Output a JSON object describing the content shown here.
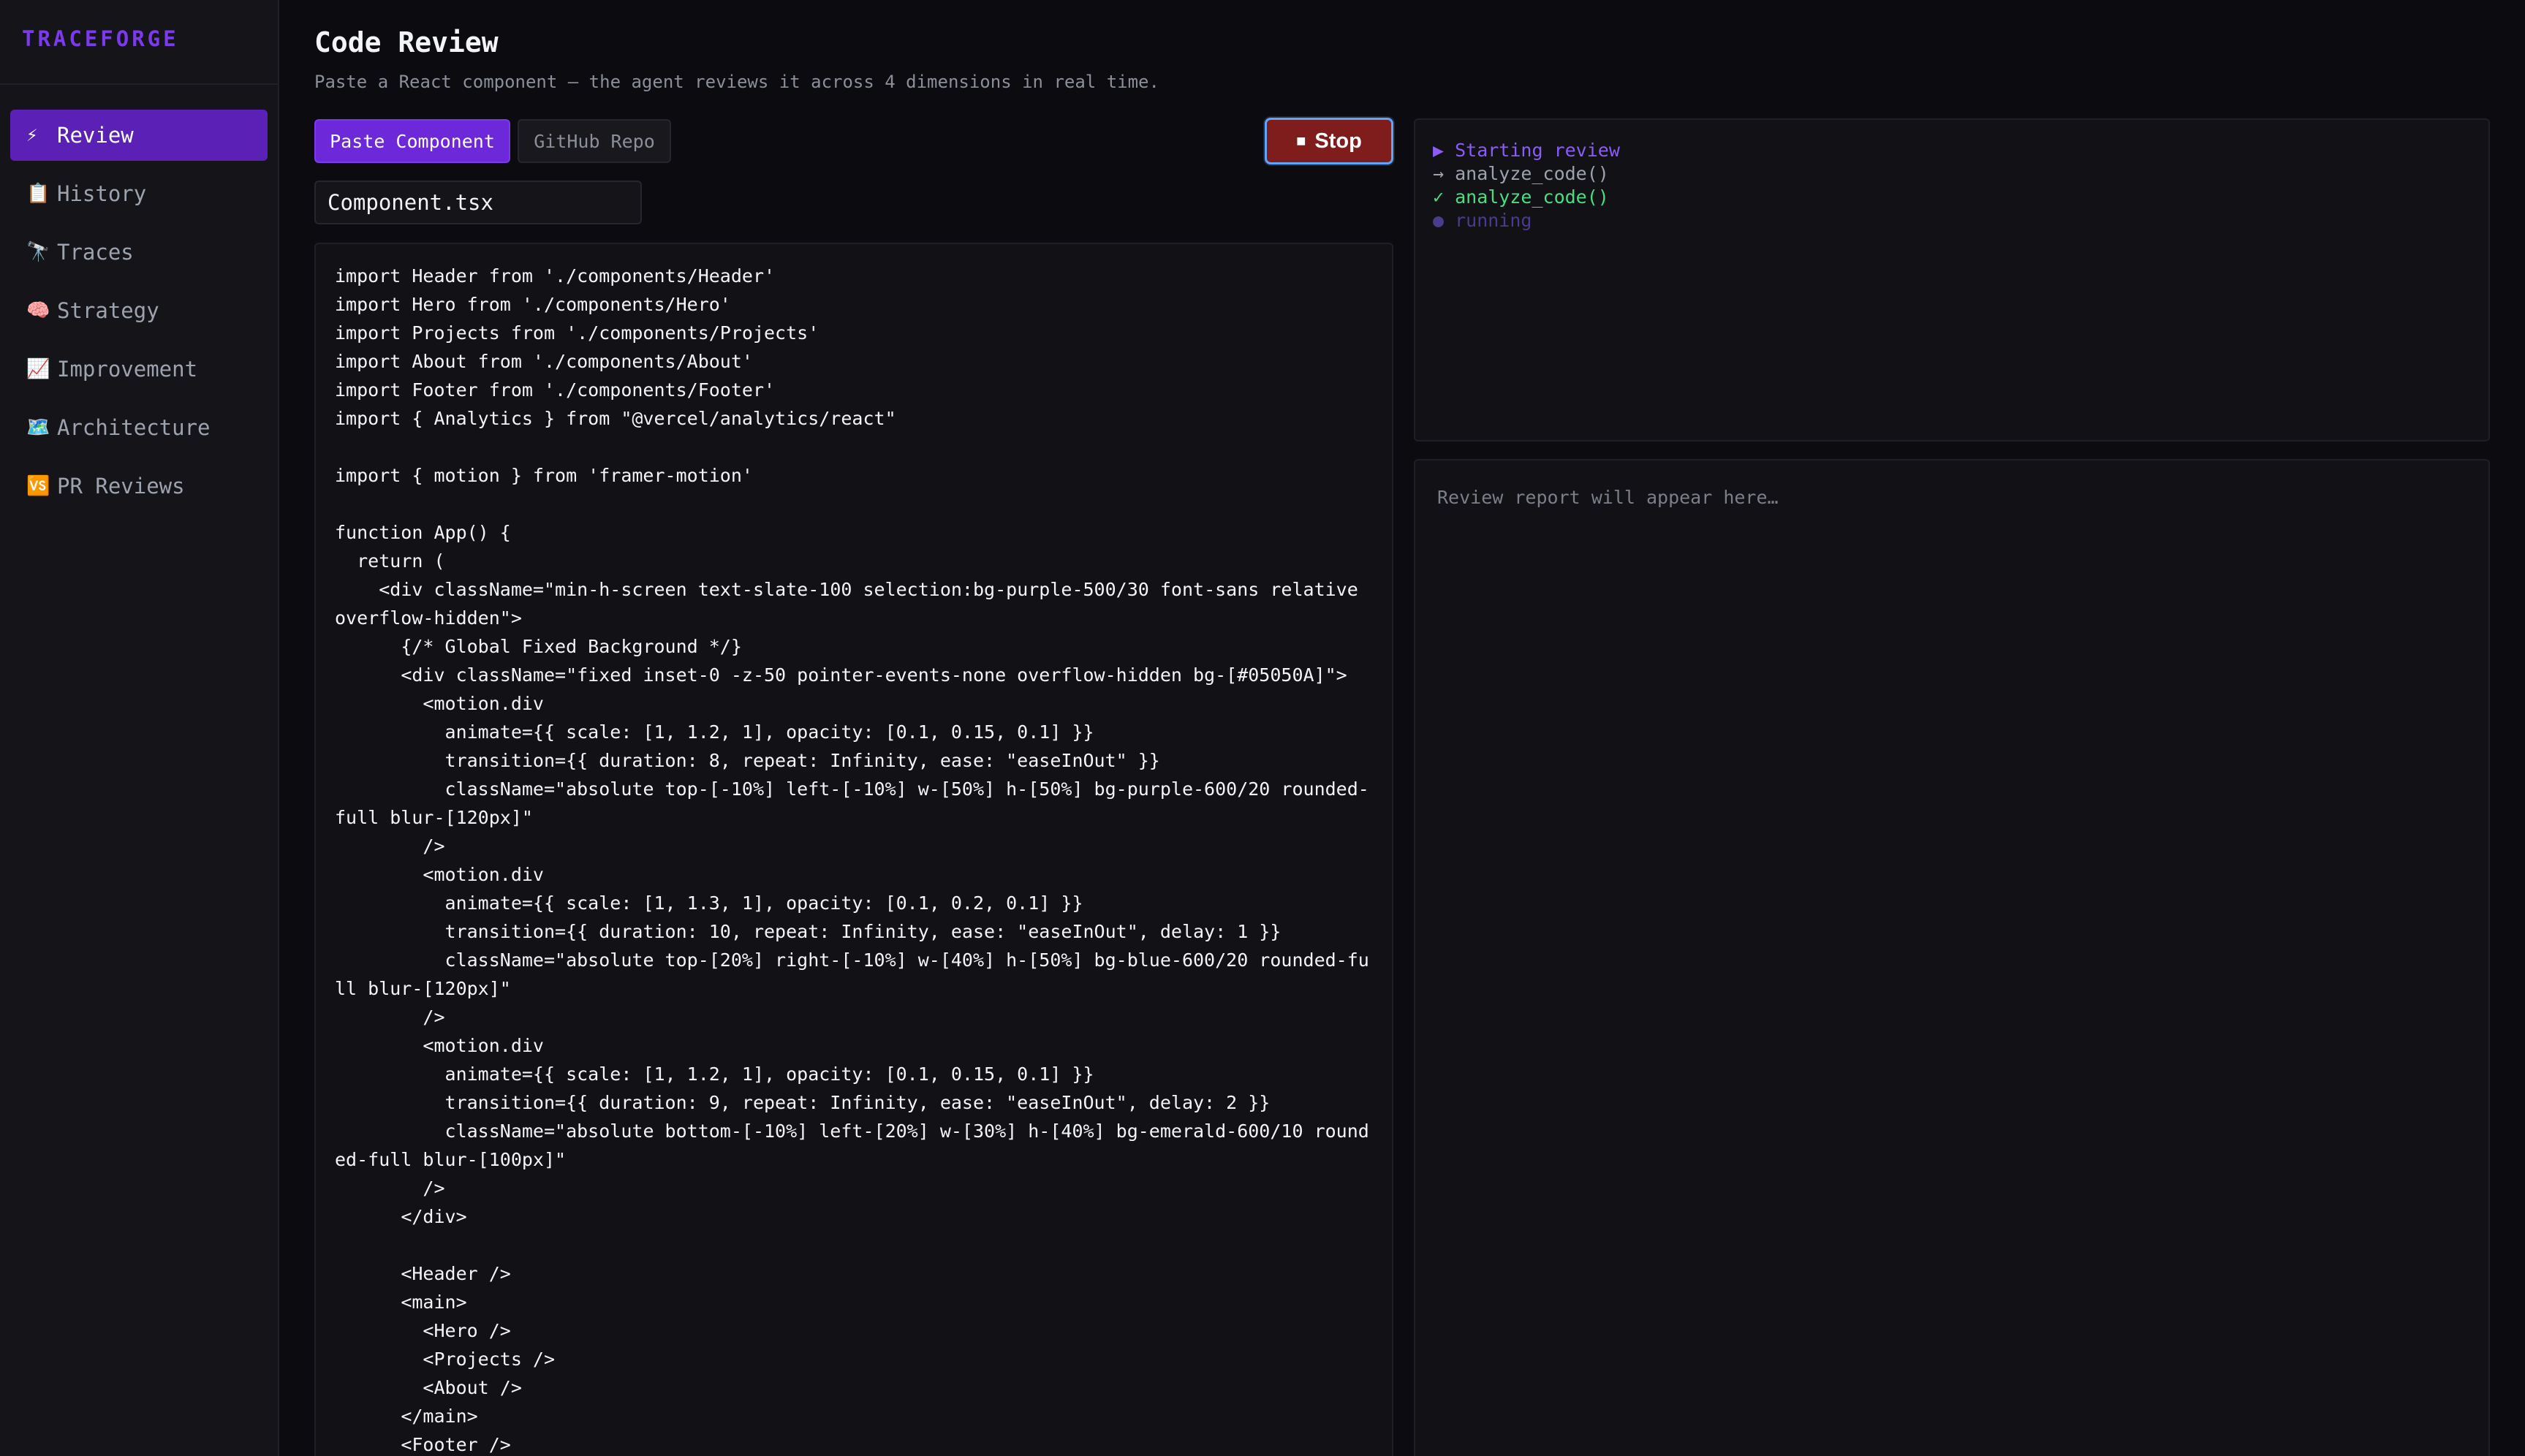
{
  "sidebar": {
    "brand": "TRACEFORGE",
    "items": [
      {
        "icon": "⚡",
        "label": "Review",
        "active": true
      },
      {
        "icon": "📋",
        "label": "History"
      },
      {
        "icon": "🔭",
        "label": "Traces"
      },
      {
        "icon": "🧠",
        "label": "Strategy"
      },
      {
        "icon": "📈",
        "label": "Improvement"
      },
      {
        "icon": "🗺️",
        "label": "Architecture"
      },
      {
        "icon": "🆚",
        "label": "PR Reviews"
      }
    ]
  },
  "header": {
    "title": "Code Review",
    "subtitle": "Paste a React component — the agent reviews it across 4 dimensions in real time."
  },
  "tabs": {
    "paste": "Paste Component",
    "github": "GitHub Repo"
  },
  "stop_button": {
    "icon": "■",
    "label": "Stop"
  },
  "file_input": {
    "value": "Component.tsx"
  },
  "code": "import Header from './components/Header'\nimport Hero from './components/Hero'\nimport Projects from './components/Projects'\nimport About from './components/About'\nimport Footer from './components/Footer'\nimport { Analytics } from \"@vercel/analytics/react\"\n\nimport { motion } from 'framer-motion'\n\nfunction App() {\n  return (\n    <div className=\"min-h-screen text-slate-100 selection:bg-purple-500/30 font-sans relative overflow-hidden\">\n      {/* Global Fixed Background */}\n      <div className=\"fixed inset-0 -z-50 pointer-events-none overflow-hidden bg-[#05050A]\">\n        <motion.div\n          animate={{ scale: [1, 1.2, 1], opacity: [0.1, 0.15, 0.1] }}\n          transition={{ duration: 8, repeat: Infinity, ease: \"easeInOut\" }}\n          className=\"absolute top-[-10%] left-[-10%] w-[50%] h-[50%] bg-purple-600/20 rounded-full blur-[120px]\"\n        />\n        <motion.div\n          animate={{ scale: [1, 1.3, 1], opacity: [0.1, 0.2, 0.1] }}\n          transition={{ duration: 10, repeat: Infinity, ease: \"easeInOut\", delay: 1 }}\n          className=\"absolute top-[20%] right-[-10%] w-[40%] h-[50%] bg-blue-600/20 rounded-full blur-[120px]\"\n        />\n        <motion.div\n          animate={{ scale: [1, 1.2, 1], opacity: [0.1, 0.15, 0.1] }}\n          transition={{ duration: 9, repeat: Infinity, ease: \"easeInOut\", delay: 2 }}\n          className=\"absolute bottom-[-10%] left-[20%] w-[30%] h-[40%] bg-emerald-600/10 rounded-full blur-[100px]\"\n        />\n      </div>\n\n      <Header />\n      <main>\n        <Hero />\n        <Projects />\n        <About />\n      </main>\n      <Footer />",
  "trace": [
    {
      "text": "▶ Starting review",
      "status": "start"
    },
    {
      "text": "→ analyze_code()",
      "status": "call"
    },
    {
      "text": "✓ analyze_code()",
      "status": "done"
    },
    {
      "text": "● running",
      "status": "running"
    }
  ],
  "report": {
    "placeholder": "Review report will appear here…"
  },
  "colors": {
    "accent": "#6d28d9",
    "brand": "#7c3aed",
    "stop": "#7f1d1d",
    "success": "#4ade80"
  }
}
